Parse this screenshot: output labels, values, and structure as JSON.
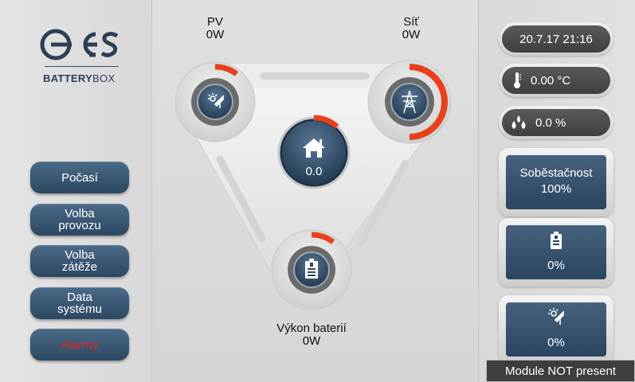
{
  "brand": {
    "name": "GES",
    "product_bold": "BATTERY",
    "product_light": "BOX"
  },
  "nav": [
    {
      "label": "Počasí"
    },
    {
      "label": "Volba\nprovozu"
    },
    {
      "label": "Volba\nzátěže"
    },
    {
      "label": "Data\nsystému"
    },
    {
      "label": "Alarmy"
    }
  ],
  "flow": {
    "pv": {
      "title": "PV",
      "value": "0W"
    },
    "grid": {
      "title": "Síť",
      "value": "0W"
    },
    "home": {
      "value": "0.0"
    },
    "battery": {
      "title": "Výkon baterií",
      "value": "0W"
    }
  },
  "status": {
    "datetime": "20.7.17 21:16",
    "temperature": "0.00 °C",
    "humidity": "0.0 %",
    "self_sufficiency_title": "Soběstačnost",
    "self_sufficiency_value": "100%",
    "battery_percent": "0%",
    "pv_percent": "0%"
  },
  "footer": {
    "module_status": "Module NOT present"
  },
  "colors": {
    "accent": "#e8401c",
    "navy": "#2c4762",
    "alarm_text": "#e82222"
  },
  "icons": {
    "pv": "solar-panel-icon",
    "grid": "power-pylon-icon",
    "home": "house-icon",
    "battery": "battery-icon",
    "temperature": "thermometer-icon",
    "humidity": "water-drops-icon"
  }
}
